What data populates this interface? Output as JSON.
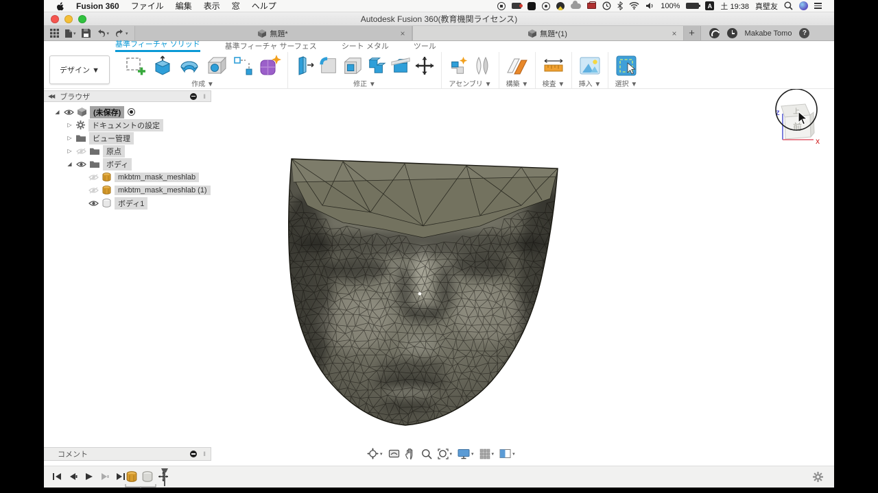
{
  "menu_bar": {
    "app_name": "Fusion 360",
    "items": [
      "ファイル",
      "編集",
      "表示",
      "窓",
      "ヘルプ"
    ],
    "status": {
      "battery_percent": "100%",
      "input_source": "A",
      "clock": "土 19:38",
      "user": "真壁友"
    }
  },
  "window_title": "Autodesk Fusion 360(教育機関ライセンス)",
  "doc_tabs": {
    "tab1": "無題*",
    "tab2": "無題*(1)",
    "account_name": "Makabe Tomo"
  },
  "ribbon": {
    "workspace_label": "デザイン ▼",
    "tabs": [
      {
        "label": "基準フィーチャ ソリッド"
      },
      {
        "label": "基準フィーチャ サーフェス"
      },
      {
        "label": "シート メタル"
      },
      {
        "label": "ツール"
      }
    ],
    "group_labels": [
      "作成 ▼",
      "修正 ▼",
      "アセンブリ ▼",
      "構築 ▼",
      "検査 ▼",
      "挿入 ▼",
      "選択 ▼"
    ]
  },
  "browser": {
    "header": "ブラウザ",
    "rows": [
      "(未保存)",
      "ドキュメントの設定",
      "ビュー管理",
      "原点",
      "ボディ",
      "mkbtm_mask_meshlab",
      "mkbtm_mask_meshlab (1)",
      "ボディ1"
    ]
  },
  "viewcube": {
    "top_label": "上",
    "front_label": "前",
    "axis_x": "X",
    "axis_z": "Z"
  },
  "comments_panel": {
    "header": "コメント"
  },
  "colors": {
    "accent_blue": "#0a99d6",
    "mesh_base": "#6e6d60",
    "mesh_top": "#73725f",
    "viewport_bg": "#ffffff"
  }
}
